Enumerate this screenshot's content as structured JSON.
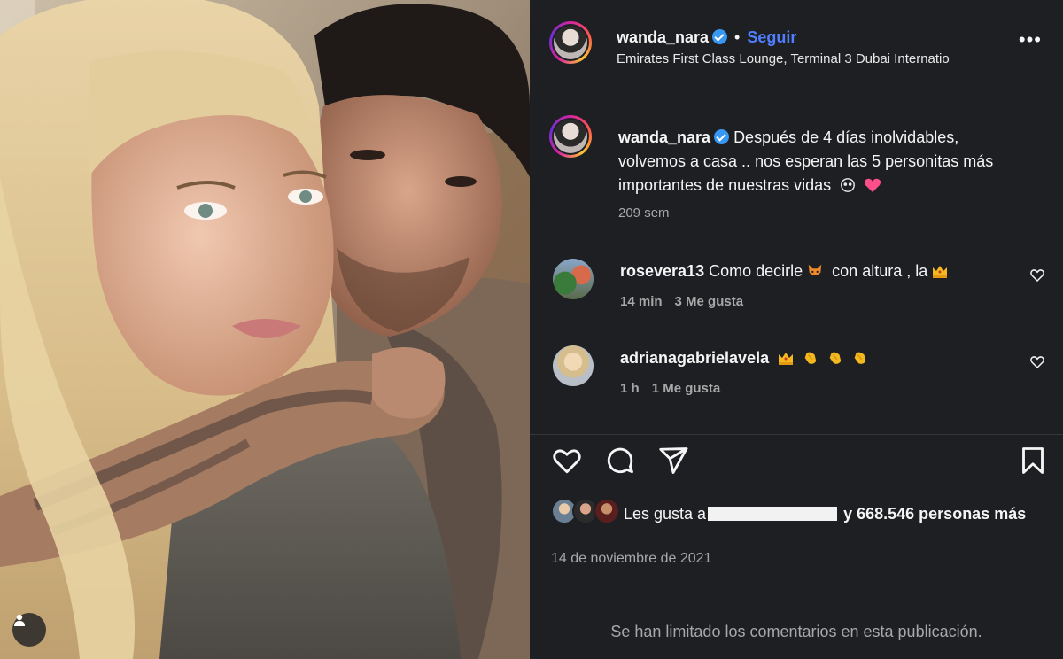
{
  "post": {
    "username": "wanda_nara",
    "follow_label": "Seguir",
    "separator": "•",
    "location": "Emirates First Class Lounge, Terminal 3 Dubai Internatio",
    "more_label": "•••"
  },
  "caption": {
    "username": "wanda_nara",
    "text": "Después de 4 días inolvidables, volvemos a casa .. nos esperan las 5 personitas más importantes de nuestras vidas",
    "time": "209 sem"
  },
  "comments": [
    {
      "username": "rosevera13",
      "text_part1": "Como decirle",
      "text_part2": "con altura , la",
      "time": "14 min",
      "likes": "3 Me gusta"
    },
    {
      "username": "adrianagabrielavela",
      "time": "1 h",
      "likes": "1 Me gusta"
    }
  ],
  "likes": {
    "prefix": "Les gusta a",
    "suffix": "y 668.546 personas más"
  },
  "date": "14 de noviembre de 2021",
  "comments_limited": "Se han limitado los comentarios en esta publicación.",
  "icons": {
    "like": "heart-icon",
    "comment": "comment-icon",
    "share": "share-icon",
    "save": "bookmark-icon",
    "tag": "person-tag-icon"
  },
  "colors": {
    "panel_bg": "#1e1f23",
    "follow": "#4f7fff",
    "verified": "#3897f0",
    "muted": "#a8a8a8"
  }
}
